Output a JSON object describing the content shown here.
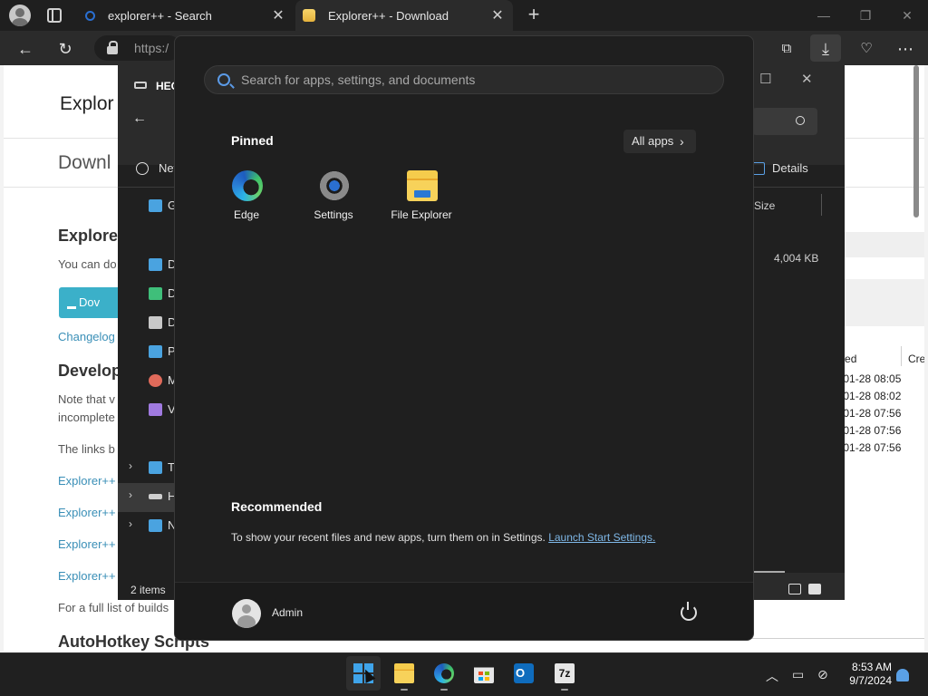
{
  "browser": {
    "tabs": [
      {
        "title": "explorer++ - Search",
        "active": false
      },
      {
        "title": "Explorer++ - Download",
        "active": true
      }
    ],
    "address_text": "https:/"
  },
  "webpage": {
    "brand": "Explor",
    "download_title": "Downl",
    "section_heading": "Explore",
    "intro_text": "You can do",
    "download_button": "Dov",
    "changelog_link": "Changelog",
    "develop_heading": "Develop",
    "note_text_1": "Note that v",
    "note_text_2": "incomplete",
    "links_text": "The links b",
    "build_links": [
      "Explorer++",
      "Explorer++",
      "Explorer++",
      "Explorer++"
    ],
    "full_list_text": "For a full list of builds",
    "ahk_heading": "AutoHotkey Scripts",
    "col_modified": "odified",
    "col_created": "Crea",
    "dates": [
      "24-01-28 08:05",
      "24-01-28 08:02",
      "24-01-28 07:56",
      "24-01-28 07:56",
      "24-01-28 07:56"
    ]
  },
  "explorer": {
    "title": "HEC",
    "new_label": "New",
    "details_label": "Details",
    "size_header": "Size",
    "size_value": "4,004 KB",
    "status": "2 items",
    "nav_items": [
      {
        "label": "G",
        "icon": "gallery-icon",
        "color": "#4aa3e0"
      },
      {
        "label": "D",
        "icon": "desktop-icon",
        "color": "#4aa3e0"
      },
      {
        "label": "D",
        "icon": "downloads-icon",
        "color": "#3fbf7a"
      },
      {
        "label": "D",
        "icon": "documents-icon",
        "color": "#c8c8c8"
      },
      {
        "label": "P",
        "icon": "pictures-icon",
        "color": "#4aa3e0"
      },
      {
        "label": "M",
        "icon": "music-icon",
        "color": "#e06a5a"
      },
      {
        "label": "V",
        "icon": "videos-icon",
        "color": "#a07ae0"
      },
      {
        "label": "T",
        "icon": "this-pc-icon",
        "color": "#4aa3e0"
      },
      {
        "label": "H",
        "icon": "drive-icon",
        "color": "#cfcfcf"
      },
      {
        "label": "N",
        "icon": "network-icon",
        "color": "#4aa3e0"
      }
    ]
  },
  "start_menu": {
    "search_placeholder": "Search for apps, settings, and documents",
    "pinned_heading": "Pinned",
    "all_apps_label": "All apps",
    "pinned_apps": [
      {
        "name": "Edge",
        "icon": "edge-icon"
      },
      {
        "name": "Settings",
        "icon": "settings-gear-icon"
      },
      {
        "name": "File Explorer",
        "icon": "file-explorer-icon"
      }
    ],
    "recommended_heading": "Recommended",
    "recommended_text": "To show your recent files and new apps, turn them on in Settings.",
    "recommended_link": "Launch Start Settings.",
    "user_name": "Admin"
  },
  "taskbar": {
    "apps": [
      "start-icon",
      "file-explorer-icon",
      "edge-icon",
      "store-icon",
      "outlook-icon",
      "7zip-icon"
    ],
    "time": "8:53 AM",
    "date": "9/7/2024"
  }
}
